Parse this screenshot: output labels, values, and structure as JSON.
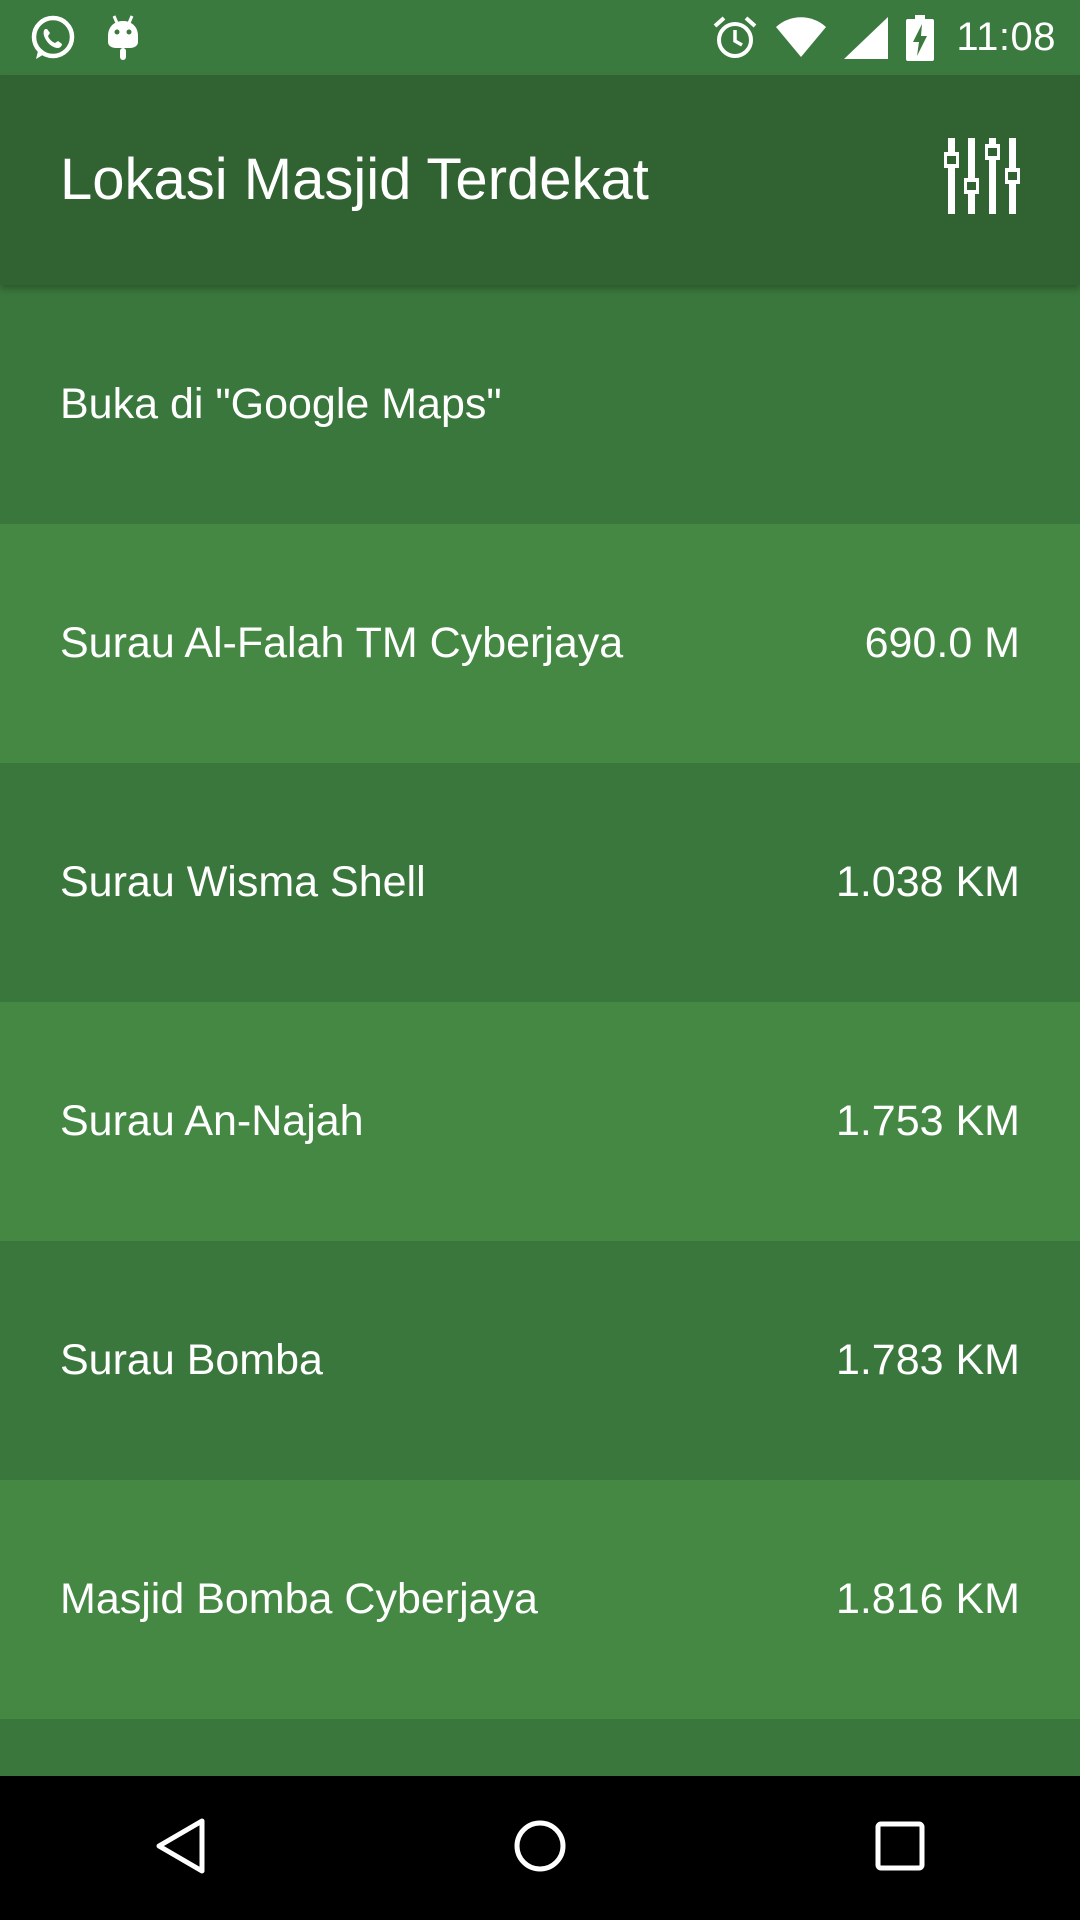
{
  "status_bar": {
    "time": "11:08",
    "left_icons": [
      "whatsapp-icon",
      "android-icon"
    ],
    "right_icons": [
      "alarm-icon",
      "wifi-icon",
      "signal-icon",
      "battery-charging-icon"
    ]
  },
  "app_bar": {
    "title": "Lokasi Masjid Terdekat",
    "action_icon": "filter-sliders-icon"
  },
  "list": {
    "items": [
      {
        "label": "Buka di \"Google Maps\"",
        "distance": ""
      },
      {
        "label": "Surau Al-Falah TM Cyberjaya",
        "distance": "690.0 M"
      },
      {
        "label": "Surau Wisma Shell",
        "distance": "1.038 KM"
      },
      {
        "label": "Surau An-Najah",
        "distance": "1.753 KM"
      },
      {
        "label": "Surau Bomba",
        "distance": "1.783 KM"
      },
      {
        "label": "Masjid Bomba Cyberjaya",
        "distance": "1.816 KM"
      },
      {
        "label": "",
        "distance": ""
      }
    ]
  },
  "nav_bar": {
    "buttons": [
      "back-icon",
      "home-icon",
      "recents-icon"
    ]
  },
  "colors": {
    "status_bar": "#3b7a3e",
    "app_bar": "#316231",
    "row_dark": "#3a773c",
    "row_light": "#448844",
    "text": "#ffffff"
  }
}
